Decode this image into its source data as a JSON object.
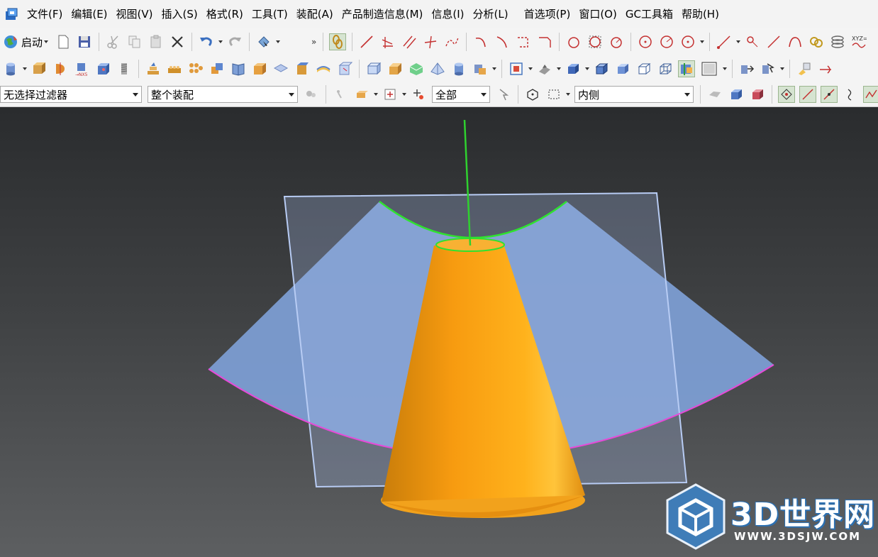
{
  "app": {
    "icon": "nx-app-icon"
  },
  "menu": [
    {
      "label": "文件(F)",
      "name": "menu-file"
    },
    {
      "label": "编辑(E)",
      "name": "menu-edit"
    },
    {
      "label": "视图(V)",
      "name": "menu-view"
    },
    {
      "label": "插入(S)",
      "name": "menu-insert"
    },
    {
      "label": "格式(R)",
      "name": "menu-format"
    },
    {
      "label": "工具(T)",
      "name": "menu-tools"
    },
    {
      "label": "装配(A)",
      "name": "menu-assembly"
    },
    {
      "label": "产品制造信息(M)",
      "name": "menu-pmi"
    },
    {
      "label": "信息(I)",
      "name": "menu-info"
    },
    {
      "label": "分析(L)",
      "name": "menu-analysis"
    },
    {
      "label": "首选项(P)",
      "name": "menu-preferences"
    },
    {
      "label": "窗口(O)",
      "name": "menu-window"
    },
    {
      "label": "GC工具箱",
      "name": "menu-gc-toolbox"
    },
    {
      "label": "帮助(H)",
      "name": "menu-help"
    }
  ],
  "toolbar": {
    "start_label": "启动",
    "more_label": "»"
  },
  "filters": {
    "selection_filter": "无选择过滤器",
    "assembly_scope": "整个装配",
    "layer_scope": "全部",
    "selection_side": "内侧"
  },
  "watermark": {
    "logo_text": "3D世界网",
    "url_text": "WWW.3DSJW.COM"
  },
  "colors": {
    "cone": "#f39a12",
    "sheet": "#7e9fd6",
    "plane": "#a8c0ee",
    "edge_green": "#2fe22f",
    "edge_magenta": "#e64ad8",
    "axis": "#2fd12f"
  }
}
